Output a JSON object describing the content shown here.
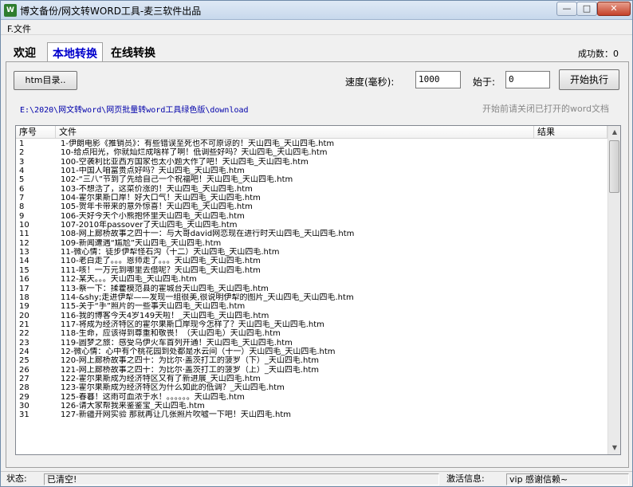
{
  "window": {
    "title": "博文备份/网文转WORD工具-麦三软件出品",
    "app_icon": "W",
    "min_glyph": "—",
    "max_glyph": "□",
    "close_glyph": "✕"
  },
  "menu": {
    "file": "F.文件"
  },
  "tabs": [
    {
      "label": "欢迎"
    },
    {
      "label": "本地转换",
      "active": true
    },
    {
      "label": "在线转换"
    }
  ],
  "success_count": "成功数：0",
  "controls": {
    "htm_button": "htm目录..",
    "speed_label": "速度(毫秒):",
    "speed_value": "1000",
    "start_label": "始于:",
    "start_value": "0",
    "start_button": "开始执行"
  },
  "path": "E:\\2020\\网文转word\\网页批量转word工具绿色版\\download",
  "hint": "开始前请关闭已打开的word文档",
  "list": {
    "columns": [
      "序号",
      "文件",
      "结果"
    ],
    "rows": [
      {
        "no": "1",
        "file": "1-伊朗电影《推销员》：有些错误至死也不可原谅的！天山四毛_天山四毛.htm"
      },
      {
        "no": "2",
        "file": "10-给点阳光，你就灿烂成啥样了啊！低调些好吗？天山四毛_天山四毛.htm"
      },
      {
        "no": "3",
        "file": "100-空袭利比亚西方国家也太小题大作了吧！天山四毛_天山四毛.htm"
      },
      {
        "no": "4",
        "file": "101-中国人咱富贵点好吗？天山四毛_天山四毛.htm"
      },
      {
        "no": "5",
        "file": "102-“三八”节到了先给自己一个祝福吧！天山四毛_天山四毛.htm"
      },
      {
        "no": "6",
        "file": "103-不想活了，这菜价涨的！天山四毛_天山四毛.htm"
      },
      {
        "no": "7",
        "file": "104-霍尔果斯口岸！好大口气！天山四毛_天山四毛.htm"
      },
      {
        "no": "8",
        "file": "105-贺年卡带来的意外惊喜！天山四毛_天山四毛.htm"
      },
      {
        "no": "9",
        "file": "106-天好今天个小熊抱怀里天山四毛_天山四毛.htm"
      },
      {
        "no": "10",
        "file": "107-2010年passover了天山四毛_天山四毛.htm"
      },
      {
        "no": "11",
        "file": "108-网上廊桥故事之四十一：与大哥david网恋现在进行时天山四毛_天山四毛.htm"
      },
      {
        "no": "12",
        "file": "109-新闻遭遇“尴尬”天山四毛_天山四毛.htm"
      },
      {
        "no": "13",
        "file": "11-微心情：徒步伊犁怪石沟（十二）天山四毛_天山四毛.htm"
      },
      {
        "no": "14",
        "file": "110-老白走了。。。恩师走了。。。天山四毛_天山四毛.htm"
      },
      {
        "no": "15",
        "file": "111-咳！一万元到哪里去借呢？天山四毛_天山四毛.htm"
      },
      {
        "no": "16",
        "file": "112-某天。。。天山四毛_天山四毛.htm"
      },
      {
        "no": "17",
        "file": "113-蔡一下：揉藿模范县的霍城台天山四毛_天山四毛.htm"
      },
      {
        "no": "18",
        "file": "114-&shy;走进伊犁——发现一组很美,很说明伊犁的图片_天山四毛_天山四毛.htm"
      },
      {
        "no": "19",
        "file": "115-关于“手”照片的一些事天山四毛_天山四毛.htm"
      },
      {
        "no": "20",
        "file": "116-我的博客今天4岁149天啦！_天山四毛_天山四毛.htm"
      },
      {
        "no": "21",
        "file": "117-将成为经济特区的霍尔果斯口岸现今怎样了？天山四毛_天山四毛.htm"
      },
      {
        "no": "22",
        "file": "118-生命，应该得到尊重和敬畏！（天山四毛）天山四毛.htm"
      },
      {
        "no": "23",
        "file": "119-圆梦之旅：感受乌伊火车首列开通！天山四毛_天山四毛.htm"
      },
      {
        "no": "24",
        "file": "12-微心情：心中有个桃花园到处都是水云间（十一）天山四毛_天山四毛.htm"
      },
      {
        "no": "25",
        "file": "120-网上廊桥故事之四十：为比尔·盖茨打工的菠罗（下）_天山四毛.htm"
      },
      {
        "no": "26",
        "file": "121-网上廊桥故事之四十：为比尔·盖茨打工的菠罗（上）_天山四毛.htm"
      },
      {
        "no": "27",
        "file": "122-霍尔果斯成为经济特区又有了新进展_天山四毛.htm"
      },
      {
        "no": "28",
        "file": "123-霍尔果斯成为经济特区为什么如此的低调？_天山四毛.htm"
      },
      {
        "no": "29",
        "file": "125-春暮！这雨可血浓于水！。。。。。。天山四毛.htm"
      },
      {
        "no": "30",
        "file": "126-请大家帮我来鉴鉴宝_天山四毛.htm"
      },
      {
        "no": "31",
        "file": "127-新疆开网实验 那就再让几张照片吹嘘一下吧！天山四毛.htm"
      }
    ]
  },
  "status": {
    "label": "状态:",
    "text": "已清空!",
    "activation_label": "激活信息:",
    "activation_text": "vip 感谢信赖~"
  }
}
